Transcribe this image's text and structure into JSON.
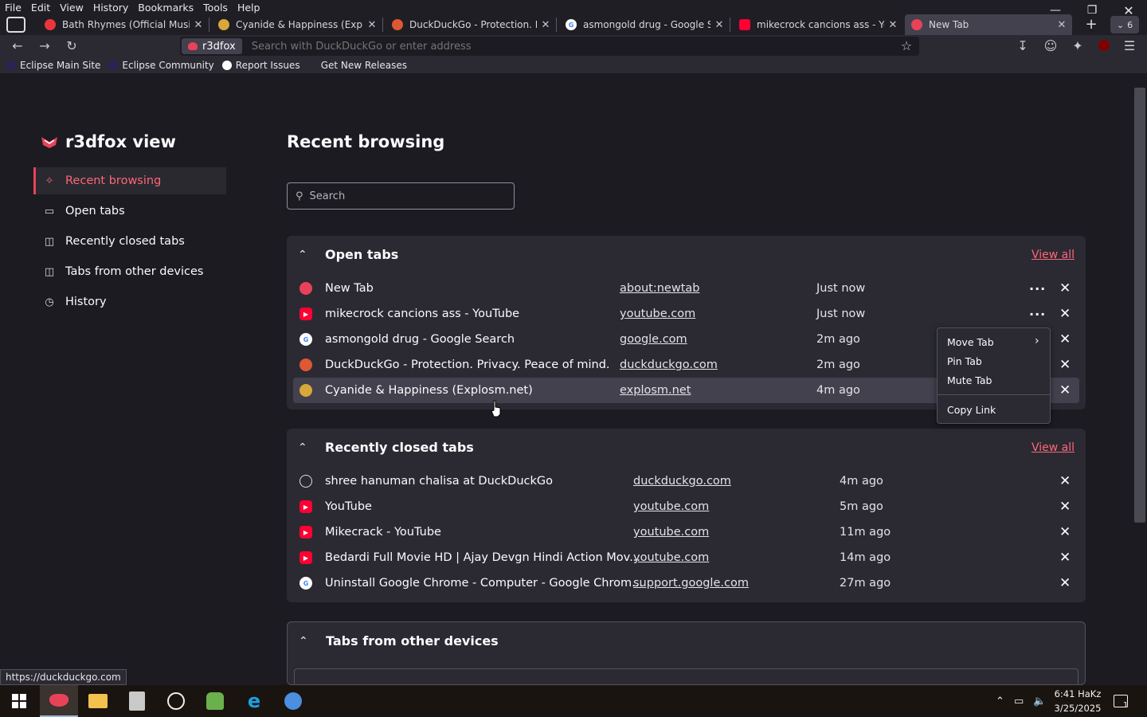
{
  "menubar": [
    "File",
    "Edit",
    "View",
    "History",
    "Bookmarks",
    "Tools",
    "Help"
  ],
  "tabs": [
    {
      "title": "Bath Rhymes (Official Music V",
      "color": "#e8363c"
    },
    {
      "title": "Cyanide & Happiness (Explosm",
      "color": "#d8a83a"
    },
    {
      "title": "DuckDuckGo - Protection. Priv",
      "color": "#de5833"
    },
    {
      "title": "asmongold drug - Google Sea",
      "color": "#4285f4"
    },
    {
      "title": "mikecrock cancions ass - YouT",
      "color": "#ff0033"
    },
    {
      "title": "New Tab",
      "color": "#e84259"
    }
  ],
  "tab_overflow_count": "6",
  "urlbar": {
    "identity": "r3dfox",
    "placeholder": "Search with DuckDuckGo or enter address"
  },
  "bookmarks": [
    {
      "label": "Eclipse Main Site",
      "color": "#2c2255"
    },
    {
      "label": "Eclipse Community",
      "color": "#2c2255"
    },
    {
      "label": "Report Issues",
      "color": "#ffffff"
    },
    {
      "label": "Get New Releases",
      "color": ""
    }
  ],
  "sidebar": {
    "brand": "r3dfox view",
    "items": [
      {
        "label": "Recent browsing",
        "icon": "sparkle-icon"
      },
      {
        "label": "Open tabs",
        "icon": "tabs-icon"
      },
      {
        "label": "Recently closed tabs",
        "icon": "closed-tabs-icon"
      },
      {
        "label": "Tabs from other devices",
        "icon": "synced-tabs-icon"
      },
      {
        "label": "History",
        "icon": "clock-icon"
      }
    ]
  },
  "main": {
    "title": "Recent browsing",
    "search_placeholder": "Search"
  },
  "open_tabs": {
    "title": "Open tabs",
    "view_all": "View all",
    "rows": [
      {
        "title": "New Tab",
        "url": "about:newtab",
        "time": "Just now"
      },
      {
        "title": "mikecrock cancions ass - YouTube",
        "url": "youtube.com",
        "time": "Just now"
      },
      {
        "title": "asmongold drug - Google Search",
        "url": "google.com",
        "time": "2m ago"
      },
      {
        "title": "DuckDuckGo - Protection. Privacy. Peace of mind.",
        "url": "duckduckgo.com",
        "time": "2m ago"
      },
      {
        "title": "Cyanide & Happiness (Explosm.net)",
        "url": "explosm.net",
        "time": "4m ago"
      }
    ]
  },
  "closed_tabs": {
    "title": "Recently closed tabs",
    "view_all": "View all",
    "rows": [
      {
        "title": "shree hanuman chalisa at DuckDuckGo",
        "url": "duckduckgo.com",
        "time": "4m ago"
      },
      {
        "title": "YouTube",
        "url": "youtube.com",
        "time": "5m ago"
      },
      {
        "title": "Mikecrack - YouTube",
        "url": "youtube.com",
        "time": "11m ago"
      },
      {
        "title": "Bedardi Full Movie HD | Ajay Devgn Hindi Action Mov...",
        "url": "youtube.com",
        "time": "14m ago"
      },
      {
        "title": "Uninstall Google Chrome - Computer - Google Chrom...",
        "url": "support.google.com",
        "time": "27m ago"
      }
    ]
  },
  "other_devices": {
    "title": "Tabs from other devices"
  },
  "context_menu": {
    "move_tab": "Move Tab",
    "pin_tab": "Pin Tab",
    "mute_tab": "Mute Tab",
    "copy_link": "Copy Link"
  },
  "status_url": "https://duckduckgo.com",
  "taskbar": {
    "time": "6:41 HaKz",
    "date": "3/25/2025",
    "notifications": "1"
  },
  "colors": {
    "accent": "#ff6577",
    "brand": "#e84259",
    "background": "#1c1b22",
    "card": "#2b2a33"
  }
}
